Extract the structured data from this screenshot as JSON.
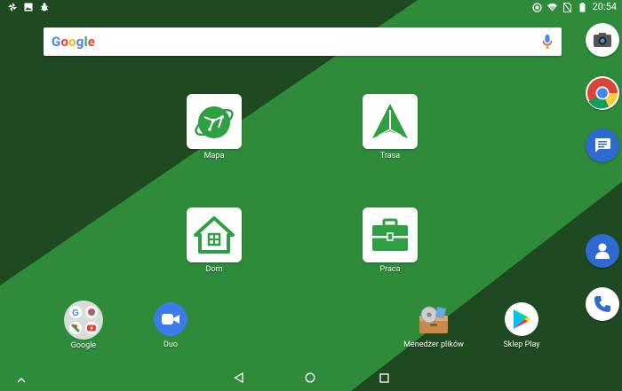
{
  "status_bar": {
    "time": "20:54",
    "left_icons": [
      "pinwheel-icon",
      "image-icon",
      "bug-icon"
    ],
    "right_icons": [
      "sync-icon",
      "wifi-icon",
      "no-sim-icon",
      "battery-icon"
    ]
  },
  "search_bar": {
    "logo": "Google",
    "mic_icon": "mic-icon"
  },
  "apps": [
    {
      "label": "Mapa",
      "icon": "globe-icon"
    },
    {
      "label": "Trasa",
      "icon": "navigation-arrow-icon"
    },
    {
      "label": "Dom",
      "icon": "home-icon"
    },
    {
      "label": "Praca",
      "icon": "briefcase-icon"
    }
  ],
  "dock": [
    {
      "label": "Google",
      "icon": "google-folder-icon"
    },
    {
      "label": "Duo",
      "icon": "video-camera-icon"
    },
    {
      "label": "Menedżer plików",
      "icon": "file-manager-icon"
    },
    {
      "label": "Sklep Play",
      "icon": "play-store-icon"
    }
  ],
  "side_shortcuts": [
    {
      "name": "camera",
      "icon": "camera-icon"
    },
    {
      "name": "chrome",
      "icon": "chrome-icon"
    },
    {
      "name": "messages",
      "icon": "message-icon"
    },
    {
      "name": "contacts",
      "icon": "contacts-icon"
    },
    {
      "name": "phone",
      "icon": "phone-icon"
    }
  ],
  "navigation": {
    "back": "back-icon",
    "home": "home-circle-icon",
    "recents": "recents-icon",
    "app_drawer": "chevron-up-icon"
  },
  "colors": {
    "wallpaper_light": "#2e8b3a",
    "wallpaper_dark": "#1f4f22",
    "app_green": "#2ea043"
  }
}
